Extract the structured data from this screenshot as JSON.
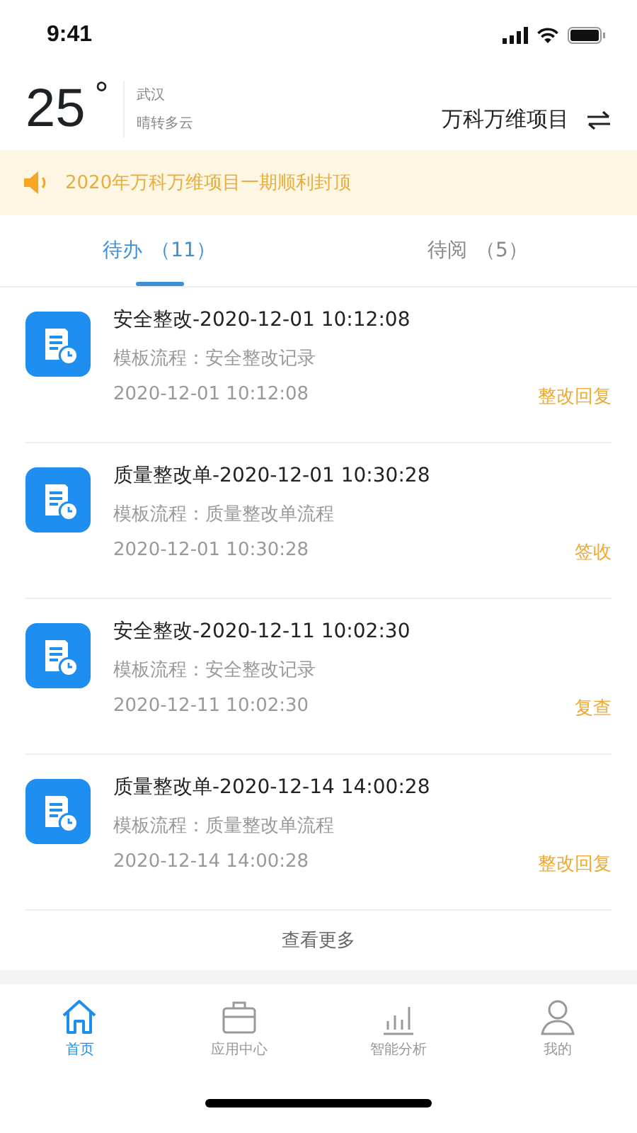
{
  "status_bar": {
    "time": "9:41"
  },
  "header": {
    "temperature": "25",
    "degree": "°",
    "city": "武汉",
    "weather": "晴转多云",
    "project": "万科万维项目"
  },
  "notice": {
    "text": "2020年万科万维项目一期顺利封顶"
  },
  "tabs": [
    {
      "label": "待办",
      "count": "（11）",
      "selected": true
    },
    {
      "label": "待阅",
      "count": "（5）",
      "selected": false
    }
  ],
  "tasks": [
    {
      "title": "安全整改-2020-12-01 10:12:08",
      "template": "模板流程：安全整改记录",
      "time": "2020-12-01 10:12:08",
      "action": "整改回复"
    },
    {
      "title": "质量整改单-2020-12-01 10:30:28",
      "template": "模板流程：质量整改单流程",
      "time": "2020-12-01 10:30:28",
      "action": "签收"
    },
    {
      "title": "安全整改-2020-12-11 10:02:30",
      "template": "模板流程：安全整改记录",
      "time": "2020-12-11 10:02:30",
      "action": "复查"
    },
    {
      "title": "质量整改单-2020-12-14 14:00:28",
      "template": "模板流程：质量整改单流程",
      "time": "2020-12-14 14:00:28",
      "action": "整改回复"
    }
  ],
  "more": "查看更多",
  "nav": [
    {
      "kind": "home",
      "label": "首页",
      "selected": true
    },
    {
      "kind": "apps",
      "label": "应用中心",
      "selected": false
    },
    {
      "kind": "chart",
      "label": "智能分析",
      "selected": false
    },
    {
      "kind": "user",
      "label": "我的",
      "selected": false
    }
  ]
}
